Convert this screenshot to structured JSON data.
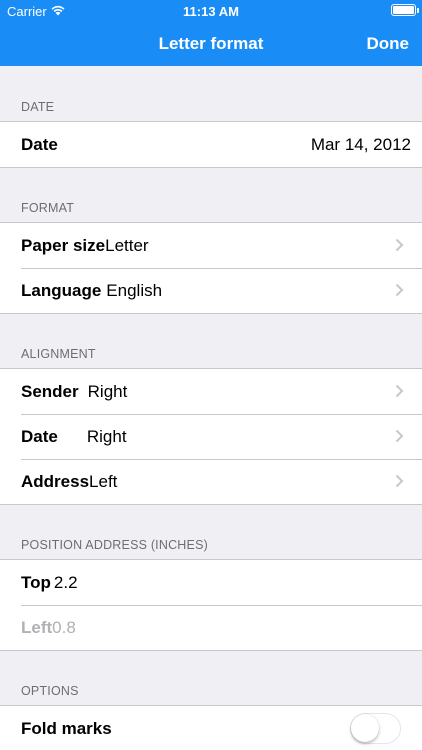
{
  "status_bar": {
    "carrier": "Carrier",
    "time": "11:13 AM"
  },
  "nav": {
    "title": "Letter format",
    "done_label": "Done"
  },
  "colors": {
    "accent": "#1a8cf5",
    "background": "#efeff4"
  },
  "sections": {
    "date": {
      "header": "DATE",
      "rows": [
        {
          "label": "Date",
          "value": "Mar 14, 2012"
        }
      ]
    },
    "format": {
      "header": "FORMAT",
      "rows": [
        {
          "label": "Paper size",
          "value": "Letter"
        },
        {
          "label": "Language",
          "value": "English"
        }
      ]
    },
    "alignment": {
      "header": "ALIGNMENT",
      "rows": [
        {
          "label": "Sender",
          "value": "Right"
        },
        {
          "label": "Date",
          "value": "Right"
        },
        {
          "label": "Address",
          "value": "Left"
        }
      ]
    },
    "position": {
      "header": "POSITION ADDRESS (INCHES)",
      "rows": [
        {
          "label": "Top",
          "value": "2.2"
        },
        {
          "label": "Left",
          "value": "0.8"
        }
      ]
    },
    "options": {
      "header": "OPTIONS",
      "rows": [
        {
          "label": "Fold marks",
          "switch_on": false
        }
      ]
    }
  }
}
